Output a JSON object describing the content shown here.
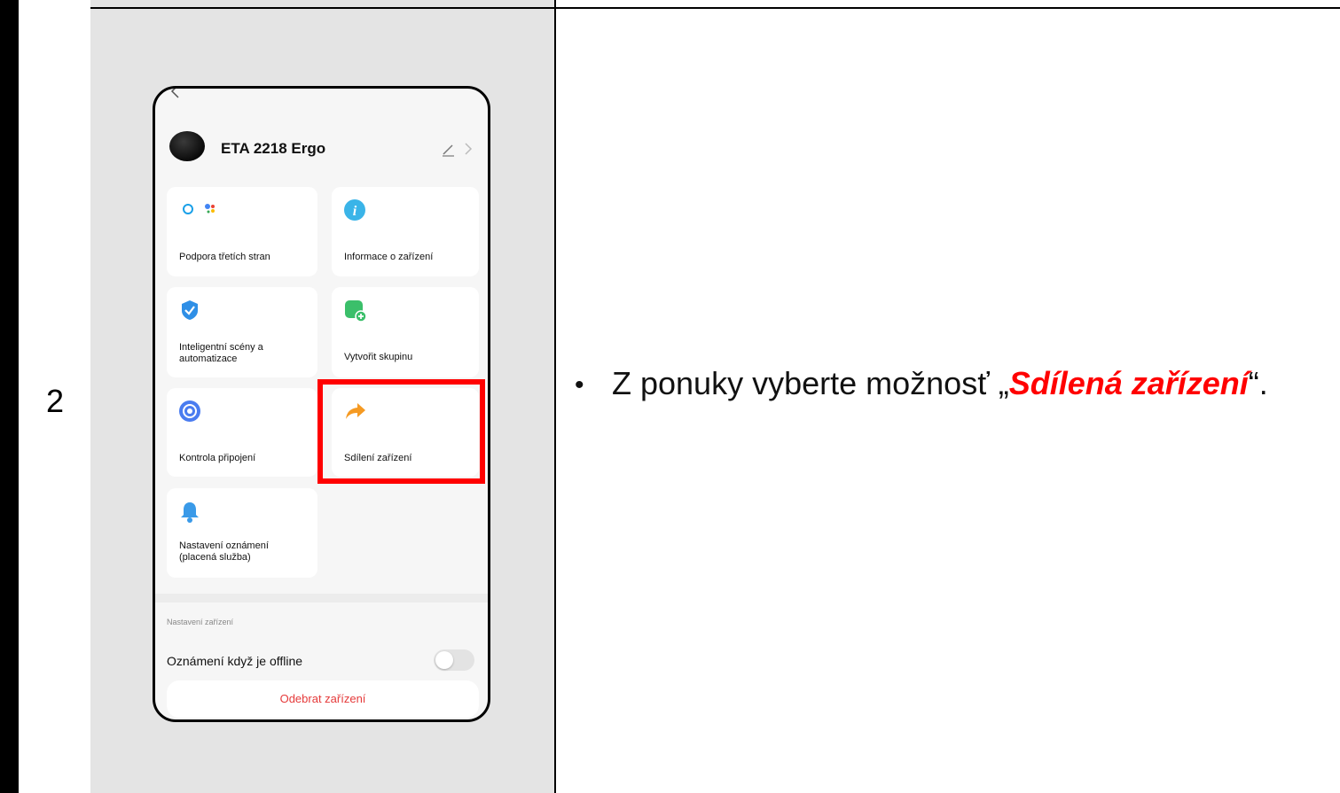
{
  "step": {
    "number": "2"
  },
  "phone": {
    "device_name": "ETA 2218 Ergo",
    "tiles": [
      {
        "label": "Podpora třetích stran",
        "icon": "third-party-icon"
      },
      {
        "label": "Informace o zařízení",
        "icon": "info-icon"
      },
      {
        "label": "Inteligentní scény a automatizace",
        "icon": "scene-icon"
      },
      {
        "label": "Vytvořit skupinu",
        "icon": "group-add-icon"
      },
      {
        "label": "Kontrola připojení",
        "icon": "connection-check-icon"
      },
      {
        "label": "Sdílení zařízení",
        "icon": "share-icon"
      },
      {
        "label": "Nastavení oznámení (placená služba)",
        "icon": "bell-icon"
      }
    ],
    "settings_section_label": "Nastavení zařízení",
    "offline_notification_label": "Oznámení když je offline",
    "offline_notification_enabled": false,
    "remove_button_label": "Odebrat zařízení"
  },
  "instruction": {
    "bullet": "•",
    "text_prefix": "Z ponuky vyberte možnosť „",
    "highlight": "Sdílená zařízení",
    "text_suffix": "“."
  },
  "colors": {
    "highlight": "#ff0000",
    "remove_text": "#e53a3a"
  }
}
